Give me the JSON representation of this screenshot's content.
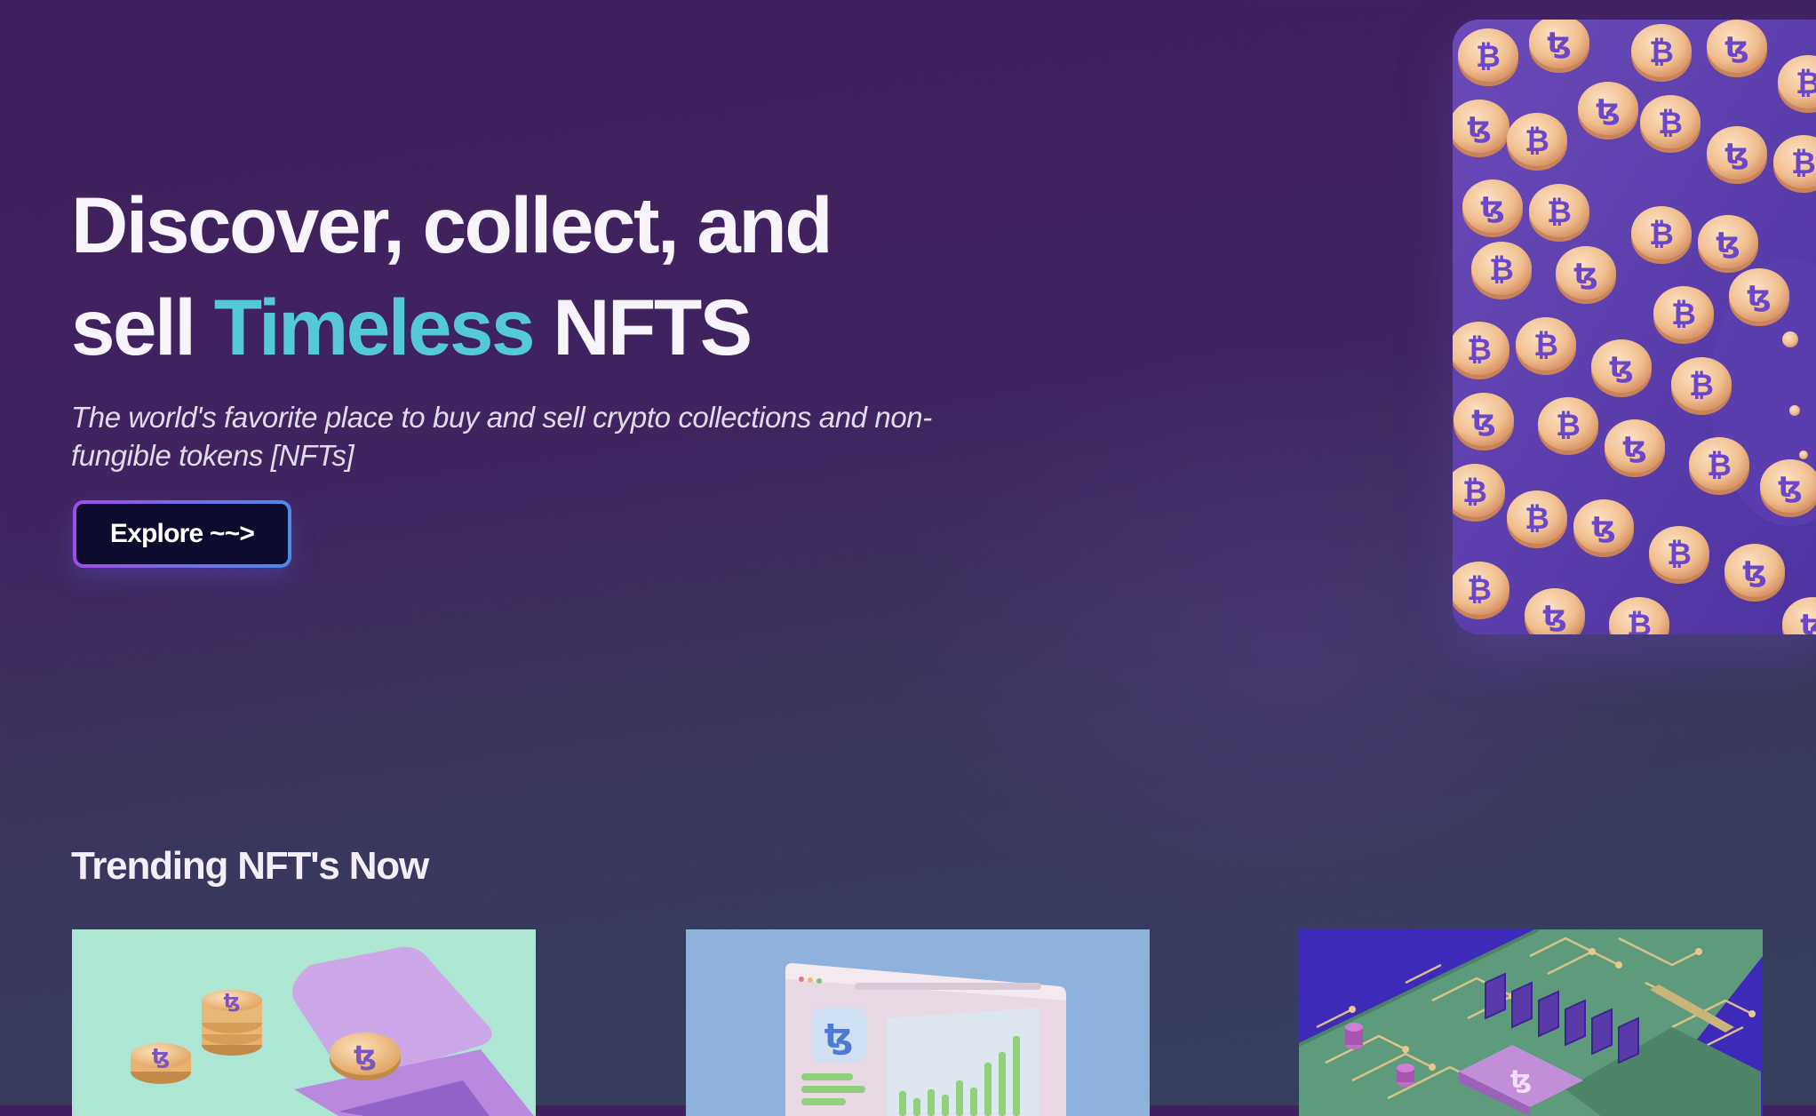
{
  "hero": {
    "title_line1": "Discover, collect, and",
    "title_line2_start": "sell ",
    "title_accent": "Timeless",
    "title_line2_end": " NFTS",
    "subtitle": "The world's favorite place to buy and sell crypto collections and non-fungible tokens [NFTs]",
    "cta_label": "Explore ~~>"
  },
  "trending": {
    "heading": "Trending NFT's Now"
  },
  "colors": {
    "accent": "#55c9d6",
    "background_top": "#3f1f5c",
    "background_bottom": "#36405e",
    "button_bg": "#0d0b2e",
    "button_border_start": "#a24be8",
    "button_border_end": "#4b8ce8"
  },
  "icons": {
    "hero_image": "crypto-coins-image",
    "card_1": "coins-laptop-image",
    "card_2": "tezos-dashboard-image",
    "card_3": "circuit-board-image"
  }
}
